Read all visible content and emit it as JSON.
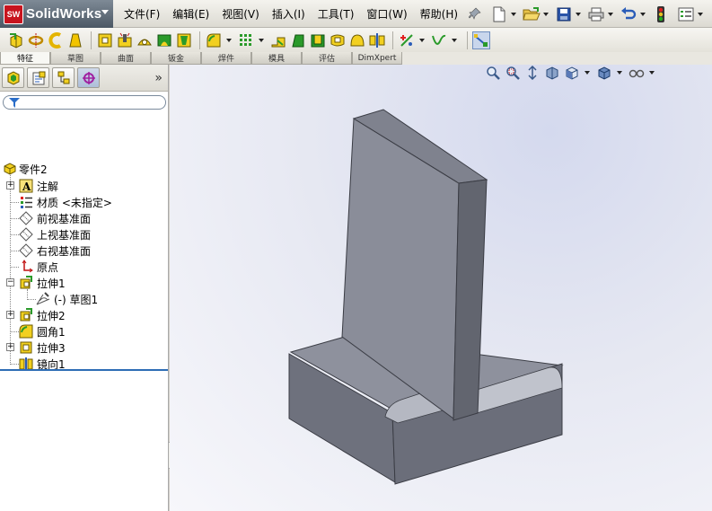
{
  "app": {
    "name": "SolidWorks",
    "badge": "SW"
  },
  "menu": [
    "文件(F)",
    "编辑(E)",
    "视图(V)",
    "插入(I)",
    "工具(T)",
    "窗口(W)",
    "帮助(H)"
  ],
  "standard_toolbar": [
    "new-icon",
    "open-icon",
    "print-icon",
    "save-icon",
    "undo-icon",
    "rebuild-icon",
    "options-icon"
  ],
  "command_manager": {
    "tabs": [
      {
        "label": "特征",
        "active": true
      },
      {
        "label": "草图"
      },
      {
        "label": "曲面"
      },
      {
        "label": "钣金"
      },
      {
        "label": "焊件"
      },
      {
        "label": "模具"
      },
      {
        "label": "评估"
      },
      {
        "label": "DimXpert"
      }
    ]
  },
  "panel": {
    "tabs": [
      "feature-manager-icon",
      "property-manager-icon",
      "configuration-manager-icon",
      "dimxpert-manager-icon"
    ],
    "more": "»"
  },
  "tree": {
    "root": "零件2",
    "items": [
      {
        "label": "注解",
        "icon": "annotation-icon",
        "expandable": true
      },
      {
        "label": "材质 <未指定>",
        "icon": "material-icon",
        "expandable": false
      },
      {
        "label": "前视基准面",
        "icon": "plane-icon",
        "expandable": false
      },
      {
        "label": "上视基准面",
        "icon": "plane-icon",
        "expandable": false
      },
      {
        "label": "右视基准面",
        "icon": "plane-icon",
        "expandable": false
      },
      {
        "label": "原点",
        "icon": "origin-icon",
        "expandable": false
      },
      {
        "label": "拉伸1",
        "icon": "extrude-icon",
        "expandable": true,
        "expanded": true
      },
      {
        "label": "(-) 草图1",
        "icon": "sketch-icon",
        "expandable": false,
        "child": true
      },
      {
        "label": "拉伸2",
        "icon": "extrude-icon",
        "expandable": true
      },
      {
        "label": "圆角1",
        "icon": "fillet-icon",
        "expandable": false
      },
      {
        "label": "拉伸3",
        "icon": "extrude-icon",
        "expandable": true
      },
      {
        "label": "镜向1",
        "icon": "mirror-icon",
        "expandable": false
      }
    ]
  },
  "colors": {
    "model_top": "#8e919d",
    "model_front": "#6e717d",
    "model_side": "#5f626d",
    "accent": "#2e6db5"
  }
}
